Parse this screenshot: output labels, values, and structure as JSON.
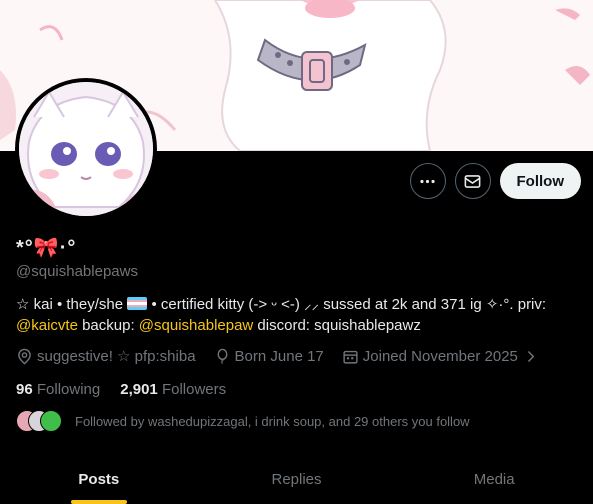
{
  "profile": {
    "display_name_prefix": "*°",
    "display_name_bow": "🎀",
    "display_name_suffix": "·°",
    "handle": "@squishablepaws",
    "bio": {
      "part1": "☆ kai • they/she",
      "part2": "• certified kitty (-> ᵕ <-) ⸝⸝ sussed at 2k and 371 ig ✧·°. priv:",
      "link1": "@kaicvte",
      "part3": " backup: ",
      "link2": "@squishablepaw",
      "part4": " discord: squishablepawz"
    },
    "location": "suggestive! ☆ pfp:shiba",
    "birthday": "Born June 17",
    "joined": "Joined November 2025",
    "following_count": "96",
    "following_label": "Following",
    "followers_count": "2,901",
    "followers_label": "Followers",
    "followed_by": "Followed by washedupizzagal, i drink soup, and 29 others you follow"
  },
  "actions": {
    "more_icon": "more-dots-icon",
    "message_icon": "envelope-icon",
    "follow_label": "Follow"
  },
  "tabs": [
    {
      "label": "Posts",
      "active": true
    },
    {
      "label": "Replies",
      "active": false
    },
    {
      "label": "Media",
      "active": false
    }
  ],
  "colors": {
    "accent": "#f5c518",
    "background": "#000000",
    "muted": "#71767b"
  }
}
